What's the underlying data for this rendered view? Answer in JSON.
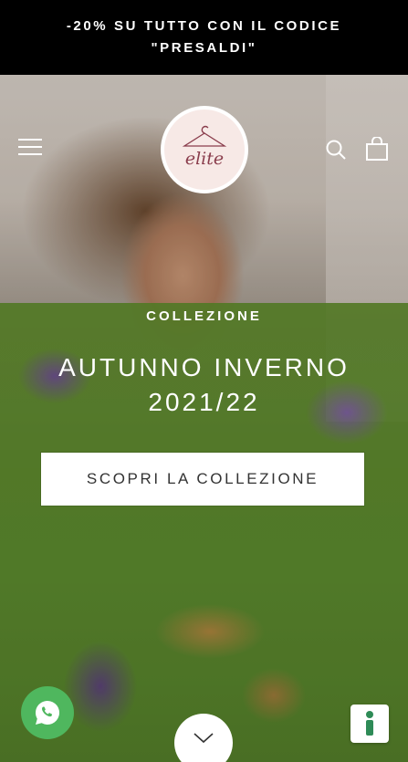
{
  "promo": {
    "line1": "-20% SU TUTTO CON IL CODICE",
    "line2": "\"PRESALDI\""
  },
  "header": {
    "logo_text": "elite",
    "icons": [
      "menu-icon",
      "search-icon",
      "cart-icon"
    ]
  },
  "hero": {
    "eyebrow": "COLLEZIONE",
    "headline_line1": "AUTUNNO INVERNO",
    "headline_line2": "2021/22",
    "cta_label": "SCOPRI LA COLLEZIONE"
  },
  "floating": {
    "whatsapp_icon": "whatsapp-icon",
    "scroll_icon": "chevron-down-icon",
    "accessibility_icon": "accessibility-icon"
  },
  "colors": {
    "promo_bg": "#000000",
    "promo_text": "#ffffff",
    "whatsapp": "#4fb75e",
    "accessibility_icon": "#2e8b57",
    "cta_text": "#333333"
  }
}
